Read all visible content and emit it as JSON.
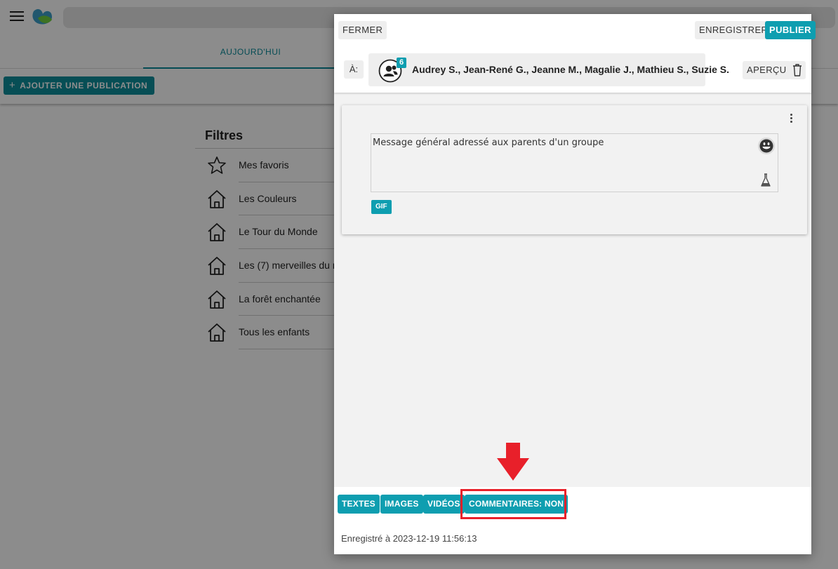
{
  "background": {
    "tabs": {
      "today_label": "AUJOURD'HUI"
    },
    "add_publication_label": "AJOUTER UNE PUBLICATION",
    "filters": {
      "title": "Filtres",
      "items": [
        {
          "label": "Mes favoris",
          "icon": "star-icon"
        },
        {
          "label": "Les Couleurs",
          "icon": "house-icon"
        },
        {
          "label": "Le Tour du Monde",
          "icon": "house-icon"
        },
        {
          "label": "Les (7) merveilles du m",
          "icon": "house-icon"
        },
        {
          "label": "La forêt enchantée",
          "icon": "house-icon"
        },
        {
          "label": "Tous les enfants",
          "icon": "house-icon"
        }
      ]
    }
  },
  "modal": {
    "close_label": "FERMER",
    "save_label": "ENREGISTRER",
    "publish_label": "PUBLIER",
    "to_label": "À:",
    "recipient_count": "6",
    "recipients": "Audrey S., Jean-René G., Jeanne M., Magalie J., Mathieu S., Suzie S.",
    "preview_label": "APERÇU",
    "message_text": "Message général adressé aux parents d'un groupe",
    "gif_label": "GIF",
    "chips": {
      "texts": "TEXTES",
      "images": "IMAGES",
      "videos": "VIDÉOS",
      "comments": "COMMENTAIRES: NON"
    },
    "saved_status": "Enregistré à 2023-12-19 11:56:13"
  },
  "colors": {
    "accent": "#0e9eb0",
    "highlight": "#e8202a"
  }
}
